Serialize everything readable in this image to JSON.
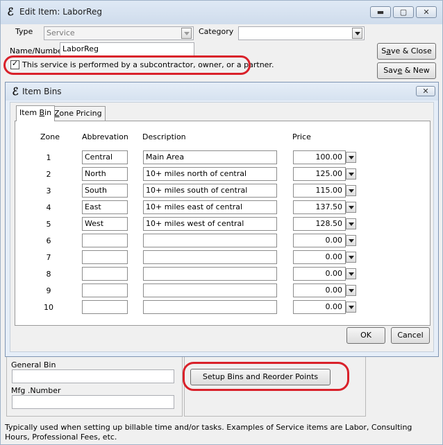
{
  "window": {
    "title": "Edit Item: LaborReg",
    "minimize": "▬",
    "maximize": "▢",
    "close": "✕"
  },
  "form": {
    "type_label": "Type",
    "type_value": "Service",
    "category_label": "Category",
    "category_value": "",
    "name_label": "Name/Number",
    "name_value": "LaborReg",
    "subcontractor_text": "This service is performed by a subcontractor, owner, or a partner.",
    "subcontractor_checked": true,
    "save_close_pre": "S",
    "save_close_u": "a",
    "save_close_post": "ve & Close",
    "save_new_pre": "Sav",
    "save_new_u": "e",
    "save_new_post": " & New",
    "general_bin_label": "General Bin",
    "general_bin_value": "",
    "mfg_number_label": "Mfg .Number",
    "mfg_number_value": "",
    "setup_bins_label": "Setup Bins and Reorder Points",
    "footer_text_1": "Typically used when setting up billable time and/or tasks.  Examples of Service items are Labor, Consulting",
    "footer_text_2": "Hours, Professional Fees, etc."
  },
  "dialog": {
    "title": "Item Bins",
    "close": "✕",
    "tabs": [
      {
        "pre": "Item ",
        "u": "B",
        "post": "in"
      },
      {
        "pre": "",
        "u": "Z",
        "post": "one Pricing"
      }
    ],
    "headers": {
      "zone": "Zone",
      "abbreviation": "Abbrevation",
      "description": "Description",
      "price": "Price"
    },
    "rows": [
      {
        "zone": "1",
        "abbr": "Central",
        "desc": "Main Area",
        "price": "100.00"
      },
      {
        "zone": "2",
        "abbr": "North",
        "desc": "10+ miles north of central",
        "price": "125.00"
      },
      {
        "zone": "3",
        "abbr": "South",
        "desc": "10+ miles south of central",
        "price": "115.00"
      },
      {
        "zone": "4",
        "abbr": "East",
        "desc": "10+ miles east of central",
        "price": "137.50"
      },
      {
        "zone": "5",
        "abbr": "West",
        "desc": "10+ miles west of central",
        "price": "128.50"
      },
      {
        "zone": "6",
        "abbr": "",
        "desc": "",
        "price": "0.00"
      },
      {
        "zone": "7",
        "abbr": "",
        "desc": "",
        "price": "0.00"
      },
      {
        "zone": "8",
        "abbr": "",
        "desc": "",
        "price": "0.00"
      },
      {
        "zone": "9",
        "abbr": "",
        "desc": "",
        "price": "0.00"
      },
      {
        "zone": "10",
        "abbr": "",
        "desc": "",
        "price": "0.00"
      }
    ],
    "ok_label": "OK",
    "cancel_label": "Cancel"
  },
  "icons": {
    "app_logo": "qb-logo-icon",
    "dropdown": "chevron-down-icon",
    "check": "check-icon"
  },
  "colors": {
    "highlight": "#d9212a",
    "title_bar": "#dfe9f5"
  }
}
